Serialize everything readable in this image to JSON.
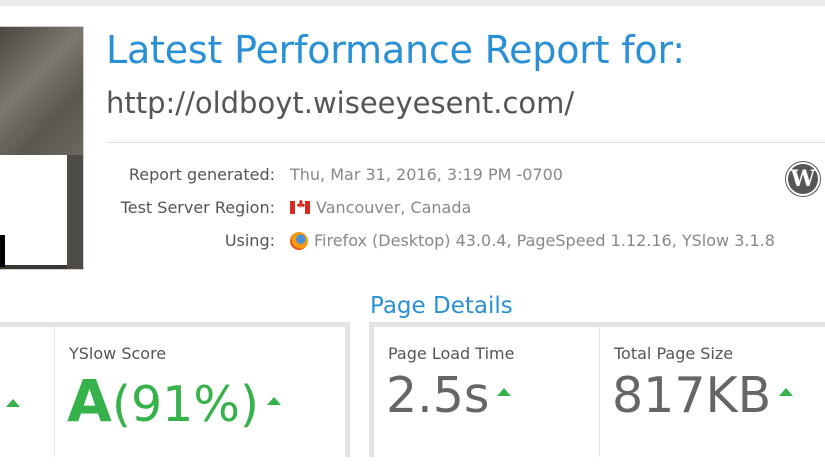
{
  "header": {
    "title": "Latest Performance Report for:",
    "url": "http://oldboyt.wiseeyesent.com/"
  },
  "meta": {
    "report_generated_label": "Report generated:",
    "report_generated_value": "Thu, Mar 31, 2016, 3:19 PM -0700",
    "region_label": "Test Server Region:",
    "region_value": "Vancouver, Canada",
    "using_label": "Using:",
    "using_value": "Firefox (Desktop) 43.0.4, PageSpeed 1.12.16, YSlow 3.1.8"
  },
  "icons": {
    "flag": "canada-flag-icon",
    "browser": "firefox-icon",
    "cms": "wordpress-icon"
  },
  "scores": {
    "yslow_label": "YSlow Score",
    "yslow_grade": "A",
    "yslow_percent": "(91%)"
  },
  "page_details": {
    "title": "Page Details",
    "load_time_label": "Page Load Time",
    "load_time_value": "2.5s",
    "page_size_label": "Total Page Size",
    "page_size_value": "817KB"
  },
  "colors": {
    "accent": "#2a90d6",
    "good": "#36b24a"
  }
}
